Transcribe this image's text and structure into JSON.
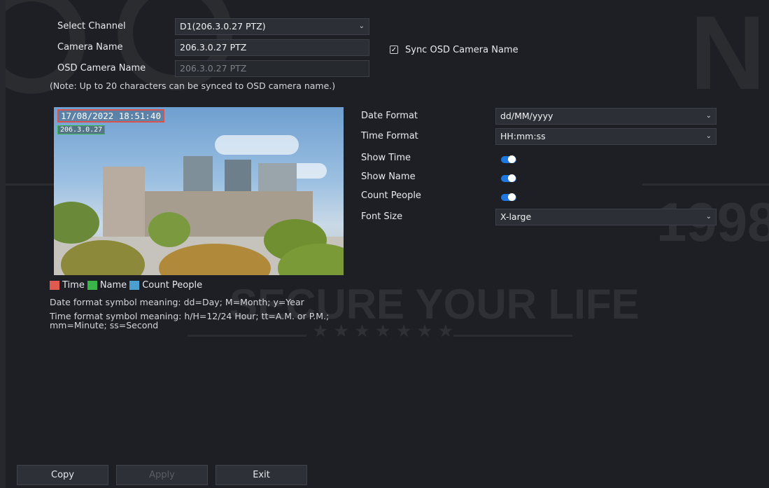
{
  "form": {
    "select_channel_label": "Select Channel",
    "select_channel_value": "D1(206.3.0.27 PTZ)",
    "camera_name_label": "Camera Name",
    "camera_name_value": "206.3.0.27 PTZ",
    "osd_camera_name_label": "OSD Camera Name",
    "osd_camera_name_value": "206.3.0.27 PTZ",
    "sync_label": "Sync OSD Camera Name",
    "sync_checked": true,
    "note": "(Note: Up to 20 characters can be synced to OSD camera name.)"
  },
  "preview": {
    "osd_time": "17/08/2022 18:51:40",
    "osd_name": "206.3.0.27"
  },
  "legend": {
    "items": [
      {
        "label": "Time",
        "color": "#e05a50"
      },
      {
        "label": "Name",
        "color": "#3ab54a"
      },
      {
        "label": "Count People",
        "color": "#4a9fd0"
      }
    ],
    "date_format_help": "Date format symbol meaning: dd=Day; M=Month; y=Year",
    "time_format_help_line1": "Time format symbol meaning: h/H=12/24 Hour; tt=A.M. or P.M.;",
    "time_format_help_line2": "mm=Minute; ss=Second"
  },
  "settings": {
    "date_format_label": "Date Format",
    "date_format_value": "dd/MM/yyyy",
    "time_format_label": "Time Format",
    "time_format_value": "HH:mm:ss",
    "show_time_label": "Show Time",
    "show_time_on": true,
    "show_name_label": "Show Name",
    "show_name_on": true,
    "count_people_label": "Count People",
    "count_people_on": true,
    "font_size_label": "Font Size",
    "font_size_value": "X-large"
  },
  "buttons": {
    "copy": "Copy",
    "apply": "Apply",
    "exit": "Exit"
  },
  "watermark": {
    "slogan": "SECURE YOUR LIFE",
    "year": "1998",
    "stars": "★ ★ ★ ★ ★ ★ ★"
  },
  "colors": {
    "accent": "#1f78e0",
    "background": "#1d1f24"
  }
}
